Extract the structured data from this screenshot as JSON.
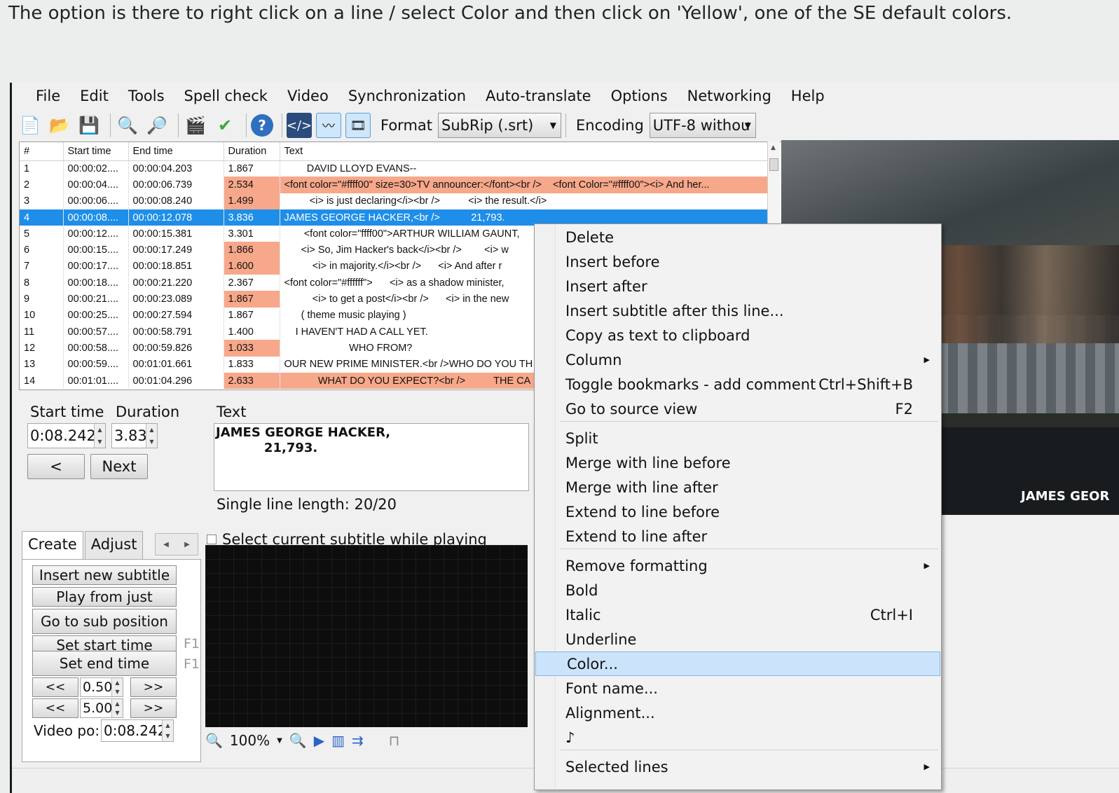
{
  "caption": "The option is there to right click on a line / select Color and then click on 'Yellow', one of the SE default colors.",
  "menu": [
    "File",
    "Edit",
    "Tools",
    "Spell check",
    "Video",
    "Synchronization",
    "Auto-translate",
    "Options",
    "Networking",
    "Help"
  ],
  "toolbar": {
    "format_label": "Format",
    "format_value": "SubRip (.srt)",
    "encoding_label": "Encoding",
    "encoding_value": "UTF-8 withou"
  },
  "grid": {
    "headers": [
      "#",
      "Start time",
      "End time",
      "Duration",
      "Text"
    ],
    "rows": [
      {
        "n": "1",
        "start": "00:00:02....",
        "end": "00:00:04.203",
        "dur": "1.867",
        "text": "        DAVID LLOYD EVANS--",
        "hl": false
      },
      {
        "n": "2",
        "start": "00:00:04....",
        "end": "00:00:06.739",
        "dur": "2.534",
        "text": "<font color=\"#ffff00\" size=30>TV announcer:</font><br />    <font Color=\"#ffff00\"><i> And her...",
        "hl": true
      },
      {
        "n": "3",
        "start": "00:00:06....",
        "end": "00:00:08.240",
        "dur": "1.499",
        "text": "         <i> is just declaring</i><br />          <i> the result.</i>",
        "hl": true
      },
      {
        "n": "4",
        "start": "00:00:08....",
        "end": "00:00:12.078",
        "dur": "3.836",
        "text": "JAMES GEORGE HACKER,<br />           21,793.",
        "hl": false
      },
      {
        "n": "5",
        "start": "00:00:12....",
        "end": "00:00:15.381",
        "dur": "3.301",
        "text": "       <font color=\"ffff00\">ARTHUR WILLIAM GAUNT,",
        "hl": false
      },
      {
        "n": "6",
        "start": "00:00:15....",
        "end": "00:00:17.249",
        "dur": "1.866",
        "text": "      <i> So, Jim Hacker's back</i><br />        <i> w",
        "hl": true
      },
      {
        "n": "7",
        "start": "00:00:17....",
        "end": "00:00:18.851",
        "dur": "1.600",
        "text": "          <i> in majority.</i><br />      <i> And after r",
        "hl": true
      },
      {
        "n": "8",
        "start": "00:00:18....",
        "end": "00:00:21.220",
        "dur": "2.367",
        "text": "<font color=\"#ffffff\">      <i> as a shadow minister,",
        "hl": false
      },
      {
        "n": "9",
        "start": "00:00:21....",
        "end": "00:00:23.089",
        "dur": "1.867",
        "text": "          <i> to get a post</i><br />      <i> in the new",
        "hl": true
      },
      {
        "n": "10",
        "start": "00:00:25....",
        "end": "00:00:27.594",
        "dur": "1.867",
        "text": "      ( theme music playing )",
        "hl": false
      },
      {
        "n": "11",
        "start": "00:00:57....",
        "end": "00:00:58.791",
        "dur": "1.400",
        "text": "    I HAVEN'T HAD A CALL YET.",
        "hl": false
      },
      {
        "n": "12",
        "start": "00:00:58....",
        "end": "00:00:59.826",
        "dur": "1.033",
        "text": "                       WHO FROM?",
        "hl": true
      },
      {
        "n": "13",
        "start": "00:00:59....",
        "end": "00:01:01.661",
        "dur": "1.833",
        "text": "OUR NEW PRIME MINISTER.<br />WHO DO YOU TH",
        "hl": false
      },
      {
        "n": "14",
        "start": "00:01:01....",
        "end": "00:01:04.296",
        "dur": "2.633",
        "text": "            WHAT DO YOU EXPECT?<br />          THE CA",
        "hl": true
      }
    ],
    "selected_row": "4"
  },
  "edit": {
    "start_time_label": "Start time",
    "duration_label": "Duration",
    "text_label": "Text",
    "start_time_value": "0:08.242",
    "duration_value": "3.83",
    "prev_button": "<",
    "next_button": "Next",
    "text_value": "JAMES GEORGE HACKER,\n           21,793.",
    "single_line_length": "Single line length:  20/20"
  },
  "video": {
    "subtitle": "JAMES GEOR"
  },
  "bottom": {
    "tab_create": "Create",
    "tab_adjust": "Adjust",
    "select_current": "Select current subtitle while playing",
    "buttons": [
      "Insert new subtitle",
      "Play from just",
      "Go to sub position",
      "Set start time",
      "Set end time"
    ],
    "fkey_f11": "F1",
    "fkey_f12": "F1",
    "back_btn": "<<",
    "fwd_btn": ">>",
    "small_val1": "0.50(",
    "small_val2": "5.00(",
    "video_pos_label": "Video po:",
    "video_pos_value": "0:08.242",
    "zoom": "100%"
  },
  "context_menu": {
    "items": [
      {
        "label": "Delete"
      },
      {
        "label": "Insert before"
      },
      {
        "label": "Insert after"
      },
      {
        "label": "Insert subtitle after this line..."
      },
      {
        "label": "Copy as text to clipboard"
      },
      {
        "label": "Column",
        "submenu": true
      },
      {
        "label": "Toggle bookmarks - add comment",
        "shortcut": "Ctrl+Shift+B"
      },
      {
        "label": "Go to source view",
        "shortcut": "F2"
      },
      {
        "label": "Split"
      },
      {
        "label": "Merge with line before"
      },
      {
        "label": "Merge with line after"
      },
      {
        "label": "Extend to line before"
      },
      {
        "label": "Extend to line after"
      },
      {
        "label": "Remove formatting",
        "submenu": true
      },
      {
        "label": "Bold"
      },
      {
        "label": "Italic",
        "shortcut": "Ctrl+I"
      },
      {
        "label": "Underline"
      },
      {
        "label": "Color...",
        "highlighted": true
      },
      {
        "label": "Font name..."
      },
      {
        "label": "Alignment..."
      },
      {
        "label": "♪"
      },
      {
        "label": "Selected lines",
        "submenu": true
      }
    ]
  }
}
